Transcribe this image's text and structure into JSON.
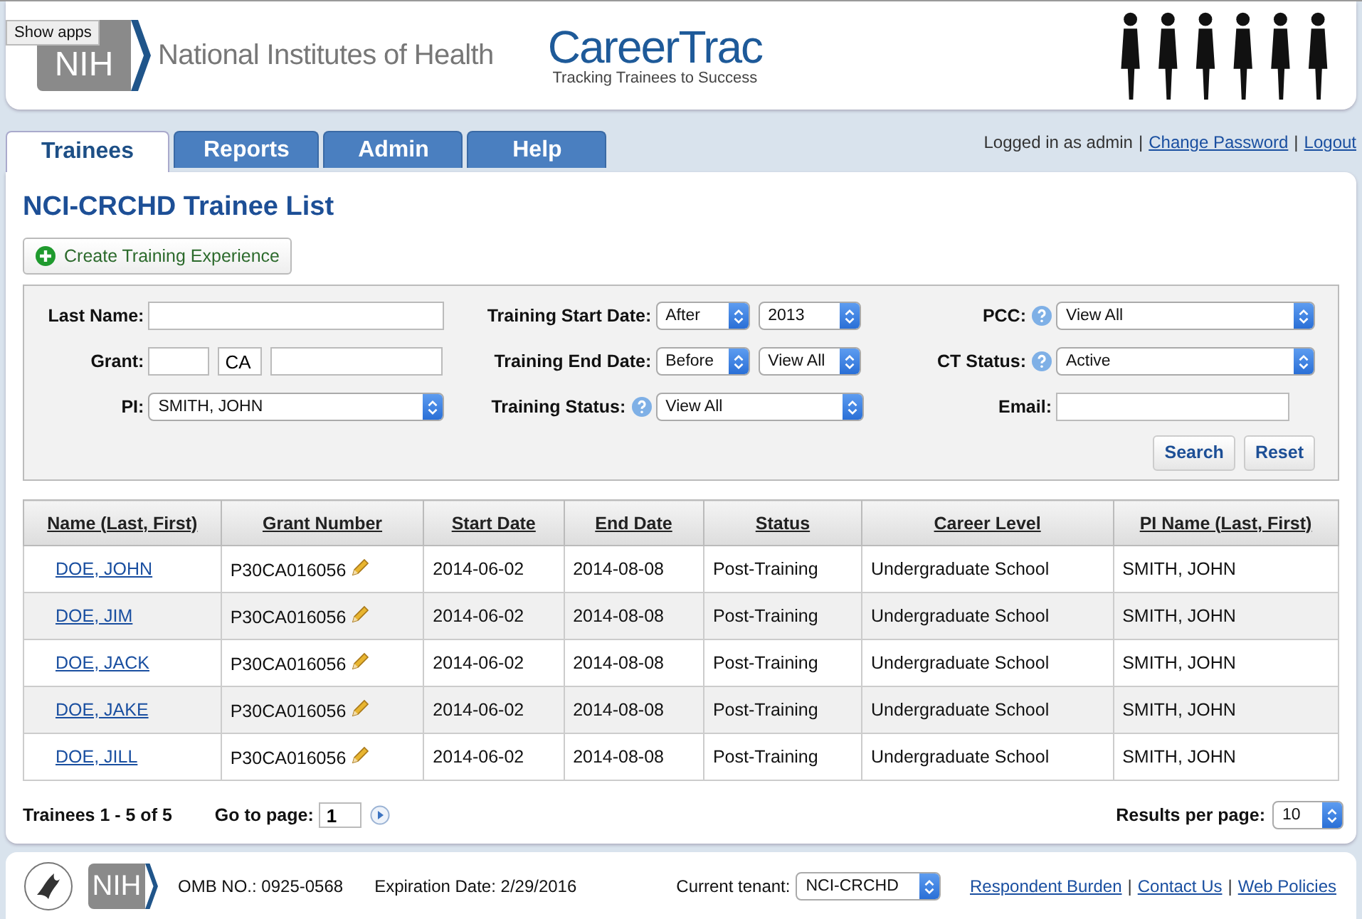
{
  "header": {
    "tooltip": "Show apps",
    "nih_logo": "NIH",
    "org_name": "National Institutes of Health",
    "app_title": "CareerTrac",
    "app_tagline": "Tracking Trainees to Success"
  },
  "tabs": [
    {
      "label": "Trainees",
      "selected": true
    },
    {
      "label": "Reports",
      "selected": false
    },
    {
      "label": "Admin",
      "selected": false
    },
    {
      "label": "Help",
      "selected": false
    }
  ],
  "user_bar": {
    "text": "Logged in as admin",
    "separator": "|",
    "links": [
      "Change Password",
      "Logout"
    ]
  },
  "page_title": "NCI-CRCHD Trainee List",
  "create_button": "Create Training Experience",
  "filters": [
    [
      {
        "kind": "text",
        "label": "Last Name:",
        "help": false
      },
      {
        "kind": "grant",
        "label": "Grant:",
        "help": false,
        "value": "CA"
      },
      {
        "kind": "select",
        "label": "PI:",
        "help": false,
        "value": "SMITH, JOHN"
      }
    ],
    [
      {
        "kind": "pair",
        "label": "Training Start Date:",
        "help": false,
        "values": [
          "After",
          "2013"
        ]
      },
      {
        "kind": "pair",
        "label": "Training End Date:",
        "help": false,
        "values": [
          "Before",
          "View All"
        ]
      },
      {
        "kind": "select",
        "label": "Training Status:",
        "help": true,
        "value": "View All"
      }
    ],
    [
      {
        "kind": "select",
        "label": "PCC:",
        "help": true,
        "value": "View All"
      },
      {
        "kind": "select",
        "label": "CT Status:",
        "help": true,
        "value": "Active"
      },
      {
        "kind": "text",
        "label": "Email:",
        "help": false
      }
    ]
  ],
  "filter_buttons": [
    "Search",
    "Reset"
  ],
  "table": {
    "columns": [
      "Name (Last, First)",
      "Grant Number",
      "Start Date",
      "End Date",
      "Status",
      "Career Level",
      "PI Name (Last, First)"
    ],
    "rows": [
      [
        "DOE, JOHN",
        "P30CA016056",
        "2014-06-02",
        "2014-08-08",
        "Post-Training",
        "Undergraduate School",
        "SMITH, JOHN"
      ],
      [
        "DOE, JIM",
        "P30CA016056",
        "2014-06-02",
        "2014-08-08",
        "Post-Training",
        "Undergraduate School",
        "SMITH, JOHN"
      ],
      [
        "DOE, JACK",
        "P30CA016056",
        "2014-06-02",
        "2014-08-08",
        "Post-Training",
        "Undergraduate School",
        "SMITH, JOHN"
      ],
      [
        "DOE, JAKE",
        "P30CA016056",
        "2014-06-02",
        "2014-08-08",
        "Post-Training",
        "Undergraduate School",
        "SMITH, JOHN"
      ],
      [
        "DOE, JILL",
        "P30CA016056",
        "2014-06-02",
        "2014-08-08",
        "Post-Training",
        "Undergraduate School",
        "SMITH, JOHN"
      ]
    ]
  },
  "pager": {
    "summary": "Trainees 1 - 5 of 5",
    "goto_label": "Go to page:",
    "goto_value": "1",
    "per_page_label": "Results per page:",
    "per_page_value": "10"
  },
  "footer": {
    "nih_logo": "NIH",
    "omb": "OMB NO.: 0925-0568",
    "expiration": "Expiration Date: 2/29/2016",
    "tenant_label": "Current tenant:",
    "tenant_value": "NCI-CRCHD",
    "separator": "|",
    "links": [
      "Respondent Burden",
      "Contact Us",
      "Web Policies"
    ]
  }
}
